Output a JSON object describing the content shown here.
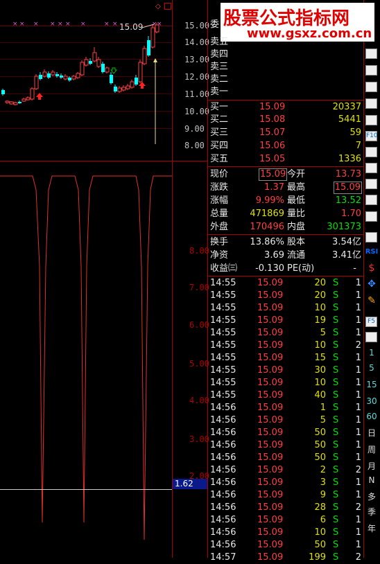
{
  "watermark": {
    "title": "股票公式指标网",
    "url": "www.gsxz.com.cn"
  },
  "price_chart": {
    "last_label": "15.09",
    "y_ticks": [
      "15.00",
      "14.00",
      "13.00",
      "12.00",
      "11.00",
      "10.00",
      "9.00",
      "8.00"
    ]
  },
  "indicator_chart": {
    "y_ticks": [
      "8.00",
      "7.00",
      "6.00",
      "5.00",
      "4.00",
      "3.00",
      "2.00"
    ],
    "current_value": "1.62"
  },
  "order_book": {
    "asks": [
      {
        "label": "卖五",
        "price": "",
        "volume": ""
      },
      {
        "label": "卖四",
        "price": "",
        "volume": ""
      },
      {
        "label": "卖三",
        "price": "",
        "volume": ""
      },
      {
        "label": "卖二",
        "price": "",
        "volume": ""
      },
      {
        "label": "卖一",
        "price": "",
        "volume": ""
      }
    ],
    "bids": [
      {
        "label": "买一",
        "price": "15.09",
        "volume": "20337"
      },
      {
        "label": "买二",
        "price": "15.08",
        "volume": "5441"
      },
      {
        "label": "买三",
        "price": "15.07",
        "volume": "59"
      },
      {
        "label": "买四",
        "price": "15.06",
        "volume": "7"
      },
      {
        "label": "买五",
        "price": "15.05",
        "volume": "1336"
      }
    ],
    "ask_header": "委"
  },
  "quote": {
    "rows": [
      {
        "l1": "现价",
        "v1": "15.09",
        "l2": "今开",
        "v2": "13.73"
      },
      {
        "l1": "涨跌",
        "v1": "1.37",
        "l2": "最高",
        "v2": "15.09"
      },
      {
        "l1": "涨幅",
        "v1": "9.99%",
        "l2": "最低",
        "v2": "13.52"
      },
      {
        "l1": "总量",
        "v1": "471869",
        "l2": "量比",
        "v2": "1.70"
      },
      {
        "l1": "外盘",
        "v1": "170496",
        "l2": "内盘",
        "v2": "301373"
      }
    ],
    "rows2": [
      {
        "l1": "换手",
        "v1": "13.86%",
        "l2": "股本",
        "v2": "3.54亿"
      },
      {
        "l1": "净资",
        "v1": "3.69",
        "l2": "流通",
        "v2": "3.41亿"
      },
      {
        "l1": "收益㈢",
        "v1": "-0.130",
        "l2": "PE(动)",
        "v2": "-"
      }
    ]
  },
  "ticks": [
    {
      "time": "14:55",
      "price": "15.09",
      "vol": "20",
      "side": "S",
      "n": "1"
    },
    {
      "time": "14:55",
      "price": "15.09",
      "vol": "20",
      "side": "S",
      "n": "1"
    },
    {
      "time": "14:55",
      "price": "15.09",
      "vol": "10",
      "side": "S",
      "n": "1"
    },
    {
      "time": "14:55",
      "price": "15.09",
      "vol": "19",
      "side": "S",
      "n": "1"
    },
    {
      "time": "14:55",
      "price": "15.09",
      "vol": "5",
      "side": "S",
      "n": "1"
    },
    {
      "time": "14:55",
      "price": "15.09",
      "vol": "10",
      "side": "S",
      "n": "2"
    },
    {
      "time": "14:55",
      "price": "15.09",
      "vol": "15",
      "side": "S",
      "n": "1"
    },
    {
      "time": "14:55",
      "price": "15.09",
      "vol": "30",
      "side": "S",
      "n": "1"
    },
    {
      "time": "14:55",
      "price": "15.09",
      "vol": "10",
      "side": "S",
      "n": "1"
    },
    {
      "time": "14:55",
      "price": "15.09",
      "vol": "40",
      "side": "S",
      "n": "1"
    },
    {
      "time": "14:56",
      "price": "15.09",
      "vol": "1",
      "side": "S",
      "n": "1"
    },
    {
      "time": "14:56",
      "price": "15.09",
      "vol": "5",
      "side": "S",
      "n": "1"
    },
    {
      "time": "14:56",
      "price": "15.09",
      "vol": "50",
      "side": "S",
      "n": "1"
    },
    {
      "time": "14:56",
      "price": "15.09",
      "vol": "50",
      "side": "S",
      "n": "1"
    },
    {
      "time": "14:56",
      "price": "15.09",
      "vol": "50",
      "side": "S",
      "n": "1"
    },
    {
      "time": "14:56",
      "price": "15.09",
      "vol": "2",
      "side": "S",
      "n": "2"
    },
    {
      "time": "14:56",
      "price": "15.09",
      "vol": "3",
      "side": "S",
      "n": "1"
    },
    {
      "time": "14:56",
      "price": "15.09",
      "vol": "9",
      "side": "S",
      "n": "1"
    },
    {
      "time": "14:56",
      "price": "15.09",
      "vol": "28",
      "side": "S",
      "n": "2"
    },
    {
      "time": "14:56",
      "price": "15.09",
      "vol": "6",
      "side": "S",
      "n": "1"
    },
    {
      "time": "14:56",
      "price": "15.09",
      "vol": "10",
      "side": "S",
      "n": "1"
    },
    {
      "time": "14:56",
      "price": "15.09",
      "vol": "50",
      "side": "S",
      "n": "1"
    },
    {
      "time": "14:57",
      "price": "15.09",
      "vol": "199",
      "side": "S",
      "n": "2"
    }
  ],
  "toolbar": {
    "periods": [
      "1",
      "5",
      "15",
      "30",
      "60",
      "日",
      "周",
      "月",
      "N",
      "多",
      "季",
      "年"
    ],
    "icons": [
      "chart-icon",
      "kline-icon",
      "ma-icon",
      "list-icon",
      "f10-icon",
      "f10b-icon",
      "money-icon",
      "f11-icon",
      "f7-icon",
      "tools-icon",
      "wave-icon",
      "rsi-icon",
      "dollar-icon",
      "move-icon",
      "pen-icon",
      "f5-icon",
      "refresh-icon"
    ],
    "rsi_label": "RSI",
    "f10_label": "F10",
    "f5_label": "F5"
  },
  "colors": {
    "up": "#ff4040",
    "down": "#00ffff",
    "grid": "#8b0000",
    "text": "#c0c0c0"
  }
}
